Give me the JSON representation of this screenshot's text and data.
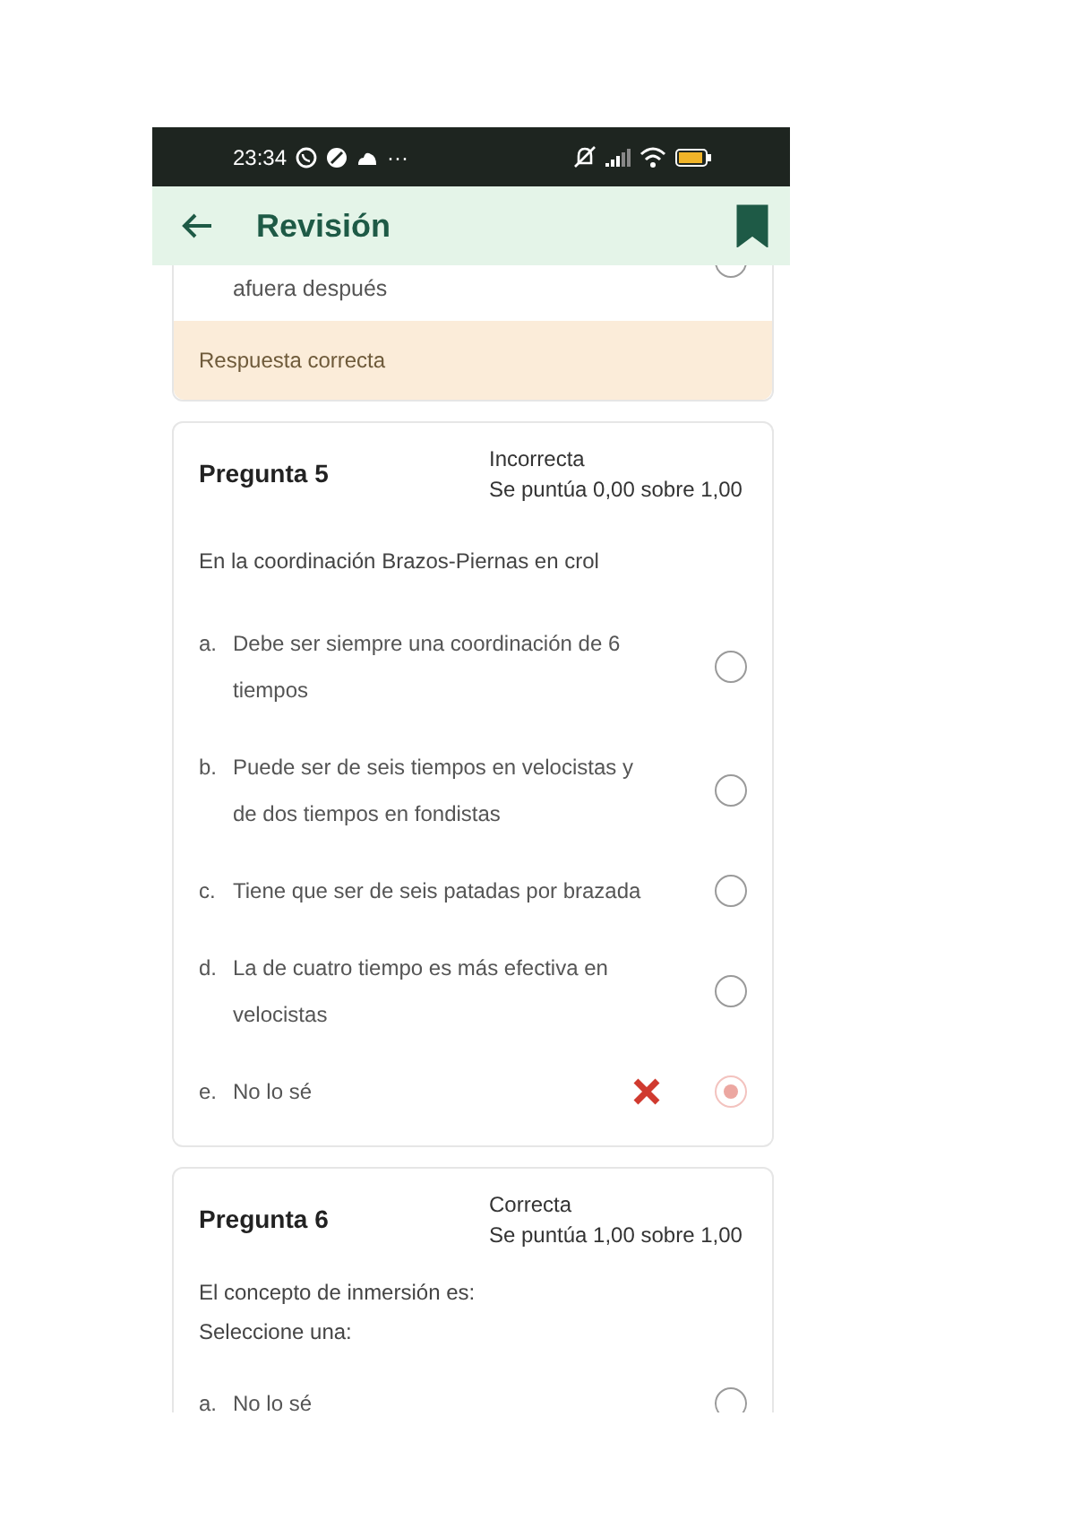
{
  "status_bar": {
    "time": "23:34",
    "more": "···"
  },
  "app_bar": {
    "title": "Revisión",
    "bookmarked": true
  },
  "previous_question": {
    "option_tail": "afuera después",
    "selected": false,
    "feedback": "Respuesta correcta"
  },
  "questions": [
    {
      "title": "Pregunta 5",
      "state": "Incorrecta",
      "grade": "Se puntúa 0,00 sobre 1,00",
      "prompt": [
        "En la coordinación Brazos-Piernas en crol"
      ],
      "options": [
        {
          "letter": "a.",
          "text": "Debe ser siempre una coordinación de 6 tiempos",
          "selected": false,
          "wrong_mark": false
        },
        {
          "letter": "b.",
          "text": "Puede ser de seis tiempos en velocistas y de dos tiempos en fondistas",
          "selected": false,
          "wrong_mark": false
        },
        {
          "letter": "c.",
          "text": "Tiene que ser de seis patadas por brazada",
          "selected": false,
          "wrong_mark": false
        },
        {
          "letter": "d.",
          "text": "La de cuatro tiempo es más efectiva en velocistas",
          "selected": false,
          "wrong_mark": false
        },
        {
          "letter": "e.",
          "text": "No lo sé",
          "selected": true,
          "wrong_mark": true
        }
      ]
    },
    {
      "title": "Pregunta 6",
      "state": "Correcta",
      "grade": "Se puntúa 1,00 sobre 1,00",
      "prompt": [
        "El concepto de inmersión es:",
        "Seleccione una:"
      ],
      "options": [
        {
          "letter": "a.",
          "text": "No lo sé",
          "selected": false,
          "wrong_mark": false
        }
      ]
    }
  ]
}
